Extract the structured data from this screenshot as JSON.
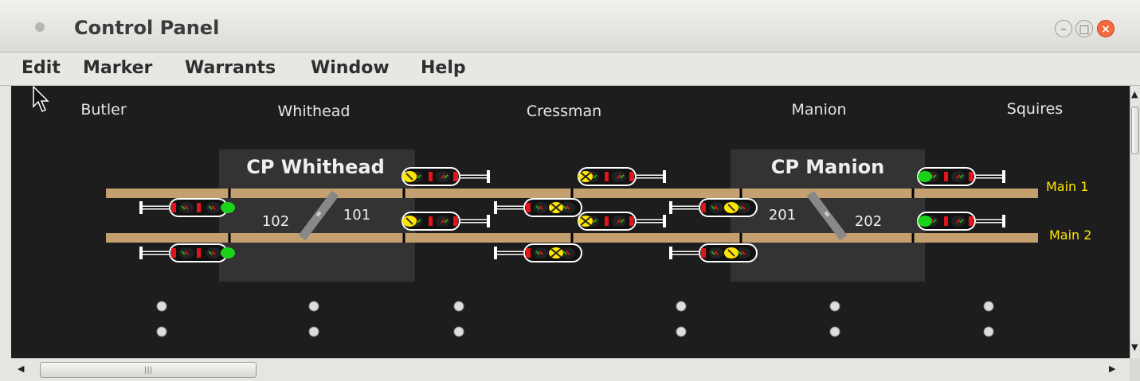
{
  "window": {
    "title": "Control Panel"
  },
  "menu": {
    "items": [
      "Edit",
      "Marker",
      "Warrants",
      "Window",
      "Help"
    ]
  },
  "panel": {
    "locations": [
      "Butler",
      "Whithead",
      "Cressman",
      "Manion",
      "Squires"
    ],
    "control_points": [
      "CP Whithead",
      "CP Manion"
    ],
    "switches": [
      "102",
      "101",
      "201",
      "202"
    ],
    "tracks": [
      "Main 1",
      "Main 2"
    ]
  },
  "colors": {
    "background": "#1d1d1d",
    "rail": "#c4a070",
    "label": "#e6e6e6",
    "track_label": "#ffe600",
    "signal_red": "#e0141a",
    "signal_yellow": "#ffe600",
    "signal_green": "#19d219",
    "cp_box": "#333333"
  }
}
